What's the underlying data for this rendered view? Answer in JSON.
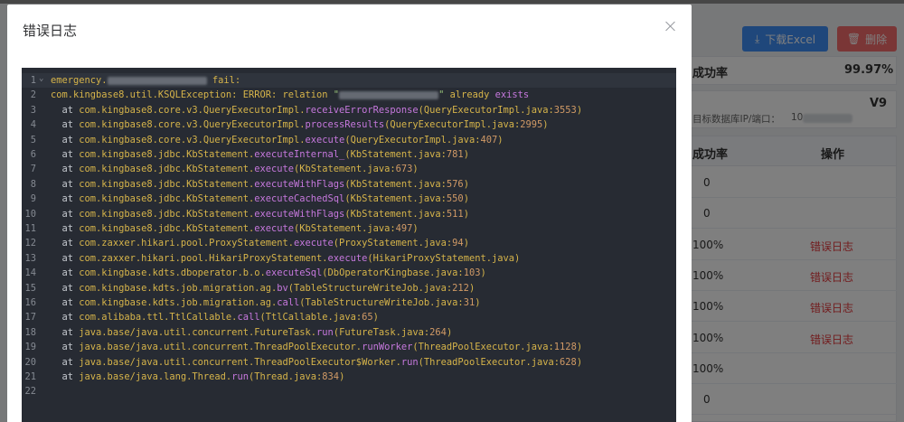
{
  "background": {
    "excel_button_label": "下载Excel",
    "delete_button_label": "删除",
    "success_rate_label": "成功率",
    "success_rate_value": "99.97%",
    "version_value": "V9",
    "target_db_label": "目标数据库IP/端口：",
    "target_db_value": "10",
    "table_header_rate": "成功率",
    "table_header_action": "操作",
    "rows": [
      {
        "rate": "0",
        "action": ""
      },
      {
        "rate": "0",
        "action": ""
      },
      {
        "rate": "100%",
        "action": "错误日志"
      },
      {
        "rate": "100%",
        "action": "错误日志"
      },
      {
        "rate": "100%",
        "action": "错误日志"
      },
      {
        "rate": "100%",
        "action": "错误日志"
      },
      {
        "rate": "100%",
        "action": ""
      },
      {
        "rate": "0",
        "action": ""
      }
    ]
  },
  "dialog": {
    "title": "错误日志",
    "close_icon": "close-icon"
  },
  "log_lines": [
    {
      "n": "1",
      "parts": [
        [
          "plain",
          "emergency."
        ],
        [
          "blur",
          ""
        ],
        [
          "plain",
          " fail:"
        ]
      ]
    },
    {
      "n": "2",
      "parts": [
        [
          "plain",
          "com.kingbase8.util.KSQLException: ERROR: relation "
        ],
        [
          "str",
          "\""
        ],
        [
          "blur",
          ""
        ],
        [
          "str",
          "\""
        ],
        [
          "plain",
          " already "
        ],
        [
          "kw",
          "exists"
        ]
      ]
    },
    {
      "n": "3",
      "parts": [
        [
          "ind",
          "  at "
        ],
        [
          "pkg",
          "com.kingbase8.core.v3.QueryExecutorImpl."
        ],
        [
          "meth",
          "receiveErrorResponse"
        ],
        [
          "src",
          "(QueryExecutorImpl.java:"
        ],
        [
          "num",
          "3553"
        ],
        [
          "src",
          ")"
        ]
      ]
    },
    {
      "n": "4",
      "parts": [
        [
          "ind",
          "  at "
        ],
        [
          "pkg",
          "com.kingbase8.core.v3.QueryExecutorImpl."
        ],
        [
          "meth",
          "processResults"
        ],
        [
          "src",
          "(QueryExecutorImpl.java:"
        ],
        [
          "num",
          "2995"
        ],
        [
          "src",
          ")"
        ]
      ]
    },
    {
      "n": "5",
      "parts": [
        [
          "ind",
          "  at "
        ],
        [
          "pkg",
          "com.kingbase8.core.v3.QueryExecutorImpl."
        ],
        [
          "meth",
          "execute"
        ],
        [
          "src",
          "(QueryExecutorImpl.java:"
        ],
        [
          "num",
          "407"
        ],
        [
          "src",
          ")"
        ]
      ]
    },
    {
      "n": "6",
      "parts": [
        [
          "ind",
          "  at "
        ],
        [
          "pkg",
          "com.kingbase8.jdbc.KbStatement."
        ],
        [
          "meth",
          "executeInternal_"
        ],
        [
          "src",
          "(KbStatement.java:"
        ],
        [
          "num",
          "781"
        ],
        [
          "src",
          ")"
        ]
      ]
    },
    {
      "n": "7",
      "parts": [
        [
          "ind",
          "  at "
        ],
        [
          "pkg",
          "com.kingbase8.jdbc.KbStatement."
        ],
        [
          "meth",
          "execute"
        ],
        [
          "src",
          "(KbStatement.java:"
        ],
        [
          "num",
          "673"
        ],
        [
          "src",
          ")"
        ]
      ]
    },
    {
      "n": "8",
      "parts": [
        [
          "ind",
          "  at "
        ],
        [
          "pkg",
          "com.kingbase8.jdbc.KbStatement."
        ],
        [
          "meth",
          "executeWithFlags"
        ],
        [
          "src",
          "(KbStatement.java:"
        ],
        [
          "num",
          "576"
        ],
        [
          "src",
          ")"
        ]
      ]
    },
    {
      "n": "9",
      "parts": [
        [
          "ind",
          "  at "
        ],
        [
          "pkg",
          "com.kingbase8.jdbc.KbStatement."
        ],
        [
          "meth",
          "executeCachedSql"
        ],
        [
          "src",
          "(KbStatement.java:"
        ],
        [
          "num",
          "550"
        ],
        [
          "src",
          ")"
        ]
      ]
    },
    {
      "n": "10",
      "parts": [
        [
          "ind",
          "  at "
        ],
        [
          "pkg",
          "com.kingbase8.jdbc.KbStatement."
        ],
        [
          "meth",
          "executeWithFlags"
        ],
        [
          "src",
          "(KbStatement.java:"
        ],
        [
          "num",
          "511"
        ],
        [
          "src",
          ")"
        ]
      ]
    },
    {
      "n": "11",
      "parts": [
        [
          "ind",
          "  at "
        ],
        [
          "pkg",
          "com.kingbase8.jdbc.KbStatement."
        ],
        [
          "meth",
          "execute"
        ],
        [
          "src",
          "(KbStatement.java:"
        ],
        [
          "num",
          "497"
        ],
        [
          "src",
          ")"
        ]
      ]
    },
    {
      "n": "12",
      "parts": [
        [
          "ind",
          "  at "
        ],
        [
          "pkg",
          "com.zaxxer.hikari.pool.ProxyStatement."
        ],
        [
          "meth",
          "execute"
        ],
        [
          "src",
          "(ProxyStatement.java:"
        ],
        [
          "num",
          "94"
        ],
        [
          "src",
          ")"
        ]
      ]
    },
    {
      "n": "13",
      "parts": [
        [
          "ind",
          "  at "
        ],
        [
          "pkg",
          "com.zaxxer.hikari.pool.HikariProxyStatement."
        ],
        [
          "meth",
          "execute"
        ],
        [
          "src",
          "(HikariProxyStatement.java)"
        ]
      ]
    },
    {
      "n": "14",
      "parts": [
        [
          "ind",
          "  at "
        ],
        [
          "pkg",
          "com.kingbase.kdts.dboperator.b.o."
        ],
        [
          "meth",
          "executeSql"
        ],
        [
          "src",
          "(DbOperatorKingbase.java:"
        ],
        [
          "num",
          "103"
        ],
        [
          "src",
          ")"
        ]
      ]
    },
    {
      "n": "15",
      "parts": [
        [
          "ind",
          "  at "
        ],
        [
          "pkg",
          "com.kingbase.kdts.job.migration.ag."
        ],
        [
          "meth",
          "bv"
        ],
        [
          "src",
          "(TableStructureWriteJob.java:"
        ],
        [
          "num",
          "212"
        ],
        [
          "src",
          ")"
        ]
      ]
    },
    {
      "n": "16",
      "parts": [
        [
          "ind",
          "  at "
        ],
        [
          "pkg",
          "com.kingbase.kdts.job.migration.ag."
        ],
        [
          "meth",
          "call"
        ],
        [
          "src",
          "(TableStructureWriteJob.java:"
        ],
        [
          "num",
          "31"
        ],
        [
          "src",
          ")"
        ]
      ]
    },
    {
      "n": "17",
      "parts": [
        [
          "ind",
          "  at "
        ],
        [
          "pkg",
          "com.alibaba.ttl.TtlCallable."
        ],
        [
          "meth",
          "call"
        ],
        [
          "src",
          "(TtlCallable.java:"
        ],
        [
          "num",
          "65"
        ],
        [
          "src",
          ")"
        ]
      ]
    },
    {
      "n": "18",
      "parts": [
        [
          "ind",
          "  at "
        ],
        [
          "pkg",
          "java.base/java.util.concurrent.FutureTask."
        ],
        [
          "meth",
          "run"
        ],
        [
          "src",
          "(FutureTask.java:"
        ],
        [
          "num",
          "264"
        ],
        [
          "src",
          ")"
        ]
      ]
    },
    {
      "n": "19",
      "parts": [
        [
          "ind",
          "  at "
        ],
        [
          "pkg",
          "java.base/java.util.concurrent.ThreadPoolExecutor."
        ],
        [
          "meth",
          "runWorker"
        ],
        [
          "src",
          "(ThreadPoolExecutor.java:"
        ],
        [
          "num",
          "1128"
        ],
        [
          "src",
          ")"
        ]
      ]
    },
    {
      "n": "20",
      "parts": [
        [
          "ind",
          "  at "
        ],
        [
          "pkg",
          "java.base/java.util.concurrent.ThreadPoolExecutor$Worker."
        ],
        [
          "meth",
          "run"
        ],
        [
          "src",
          "(ThreadPoolExecutor.java:"
        ],
        [
          "num",
          "628"
        ],
        [
          "src",
          ")"
        ]
      ]
    },
    {
      "n": "21",
      "parts": [
        [
          "ind",
          "  at "
        ],
        [
          "pkg",
          "java.base/java.lang.Thread."
        ],
        [
          "meth",
          "run"
        ],
        [
          "src",
          "(Thread.java:"
        ],
        [
          "num",
          "834"
        ],
        [
          "src",
          ")"
        ]
      ]
    },
    {
      "n": "22",
      "parts": []
    }
  ]
}
